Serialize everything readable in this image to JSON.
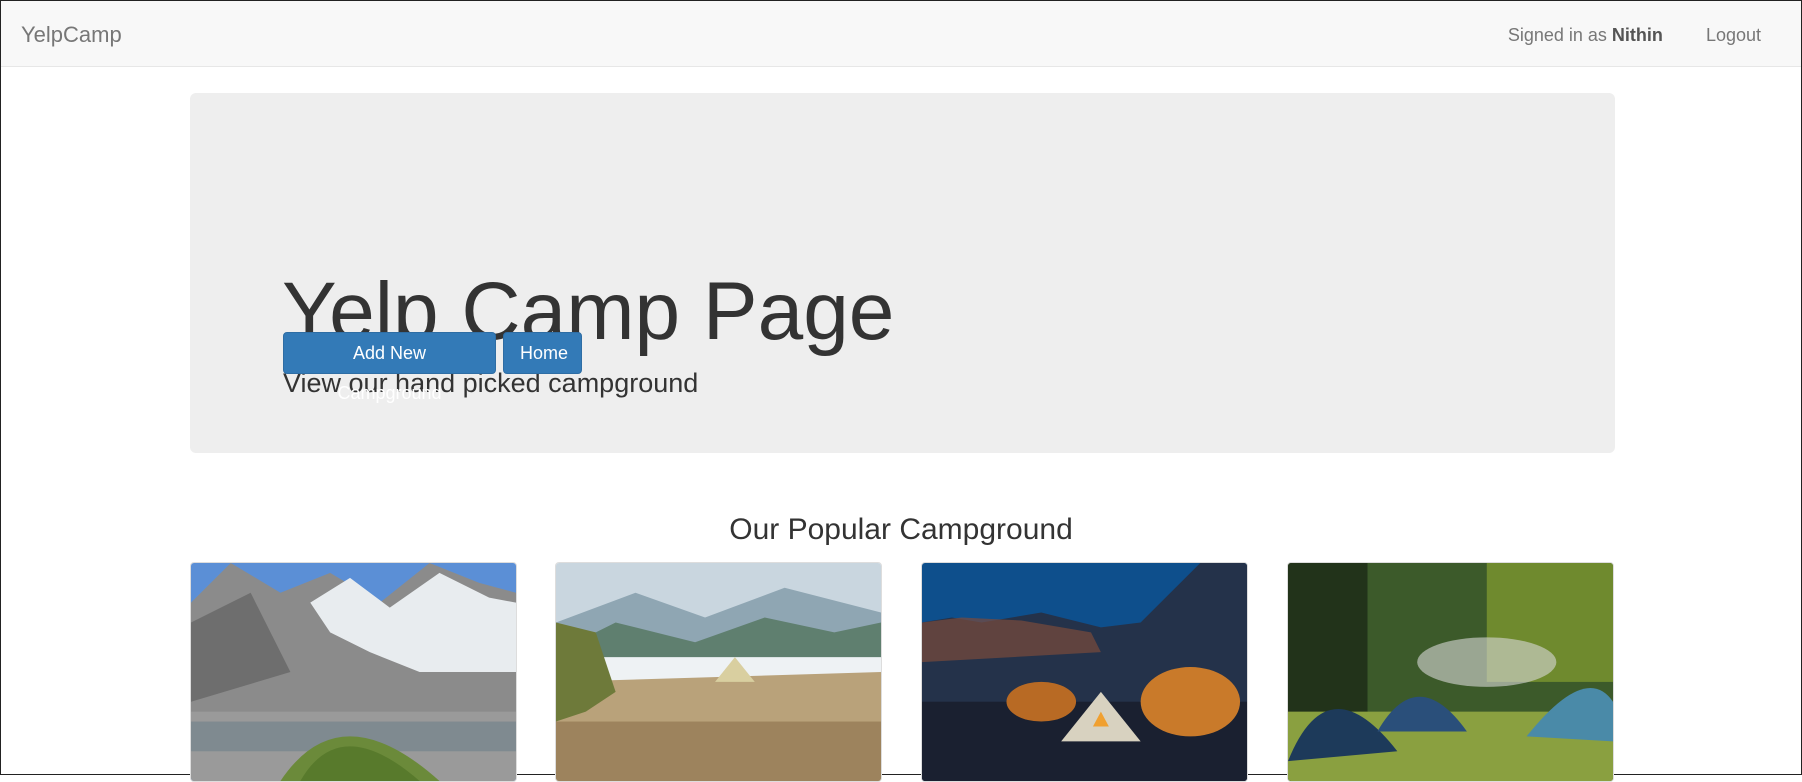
{
  "navbar": {
    "brand": "YelpCamp",
    "signed_in_prefix": "Signed in as",
    "username": "Nithin",
    "logout": "Logout"
  },
  "jumbotron": {
    "title": "Yelp Camp Page",
    "subtitle": "View our hand picked campground",
    "add_button": "Add New Campground",
    "home_button": "Home"
  },
  "section": {
    "title": "Our Popular Campground"
  },
  "colors": {
    "primary": "#337ab7",
    "jumbotron_bg": "#eeeeee",
    "navbar_bg": "#f8f8f8"
  }
}
